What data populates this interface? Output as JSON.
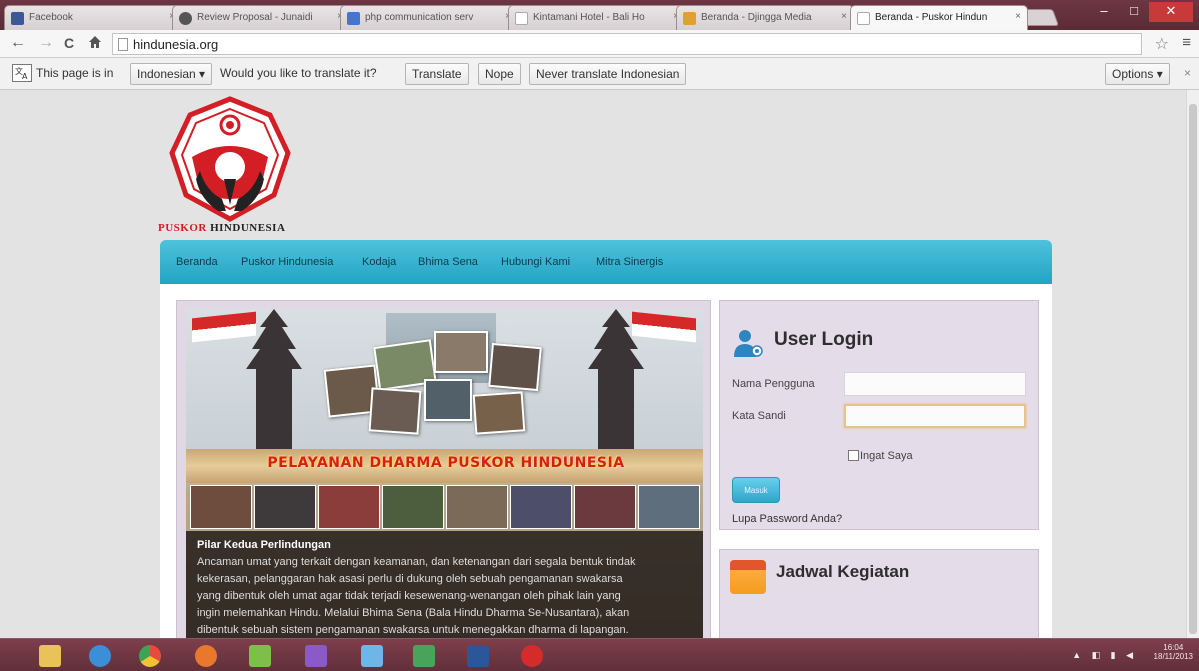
{
  "browser": {
    "tabs": [
      {
        "label": "Facebook",
        "fav_color": "#3b5998"
      },
      {
        "label": "Review Proposal - Junaidi",
        "fav_color": "#555555"
      },
      {
        "label": "php communication serv",
        "fav_color": "#4477cc"
      },
      {
        "label": "Kintamani Hotel - Bali Ho",
        "fav_color": "#bbbbbb"
      },
      {
        "label": "Beranda - Djingga Media",
        "fav_color": "#e0a030"
      },
      {
        "label": "Beranda - Puskor Hindun",
        "fav_color": "#cccccc"
      }
    ],
    "tab_close": "×",
    "window_buttons": {
      "minimize": "–",
      "maximize": "□",
      "close": "✕"
    },
    "nav": {
      "back": "←",
      "forward": "→",
      "reload": "C",
      "home": "🏠"
    },
    "url": "hindunesia.org",
    "star": "☆",
    "menu": "≡"
  },
  "translate_bar": {
    "prefix": "This page is in",
    "language": "Indonesian ▾",
    "question": "Would you like to translate it?",
    "translate": "Translate",
    "nope": "Nope",
    "never": "Never translate Indonesian",
    "options": "Options ▾",
    "close": "×"
  },
  "site": {
    "logo_text_red": "PUSKOR",
    "logo_text_black": " HINDUNESIA",
    "nav": [
      "Beranda",
      "Puskor Hindunesia",
      "Kodaja",
      "Bhima Sena",
      "Hubungi Kami",
      "Mitra Sinergis"
    ],
    "slider": {
      "banner_title": "PELAYANAN DHARMA PUSKOR HINDUNESIA",
      "caption_title": "Pilar Kedua Perlindungan",
      "caption_lines": [
        "Ancaman umat yang terkait dengan keamanan, dan ketenangan dari segala bentuk tindak",
        "kekerasan, pelanggaran hak asasi perlu di dukung oleh sebuah pengamanan swakarsa",
        "yang dibentuk oleh umat agar tidak terjadi kesewenang-wenangan oleh pihak lain yang",
        "ingin melemahkan Hindu. Melalui Bhima Sena (Bala Hindu Dharma Se-Nusantara), akan",
        "dibentuk sebuah sistem pengamanan swakarsa untuk menegakkan dharma di lapangan."
      ]
    },
    "login": {
      "title": "User Login",
      "username_label": "Nama Pengguna",
      "password_label": "Kata Sandi",
      "username_value": "",
      "password_value": "",
      "remember": "Ingat Saya",
      "submit": "Masuk",
      "forgot": "Lupa Password Anda?"
    },
    "jadwal_title": "Jadwal Kegiatan"
  },
  "taskbar": {
    "icons": [
      {
        "name": "file-explorer-icon",
        "color": "#e9c25a"
      },
      {
        "name": "internet-explorer-icon",
        "color": "#3b8fd9"
      },
      {
        "name": "chrome-icon",
        "color": "#e84a3b"
      },
      {
        "name": "firefox-icon",
        "color": "#e8782b"
      },
      {
        "name": "mail-app-icon",
        "color": "#7cc04a"
      },
      {
        "name": "visual-studio-icon",
        "color": "#8a5ac8"
      },
      {
        "name": "paint-icon",
        "color": "#6fb6e8"
      },
      {
        "name": "network-app-icon",
        "color": "#4aa35a"
      },
      {
        "name": "word-icon",
        "color": "#2b579a"
      },
      {
        "name": "record-app-icon",
        "color": "#d52b2b"
      }
    ],
    "time": "16:04",
    "date": "18/11/2013"
  }
}
